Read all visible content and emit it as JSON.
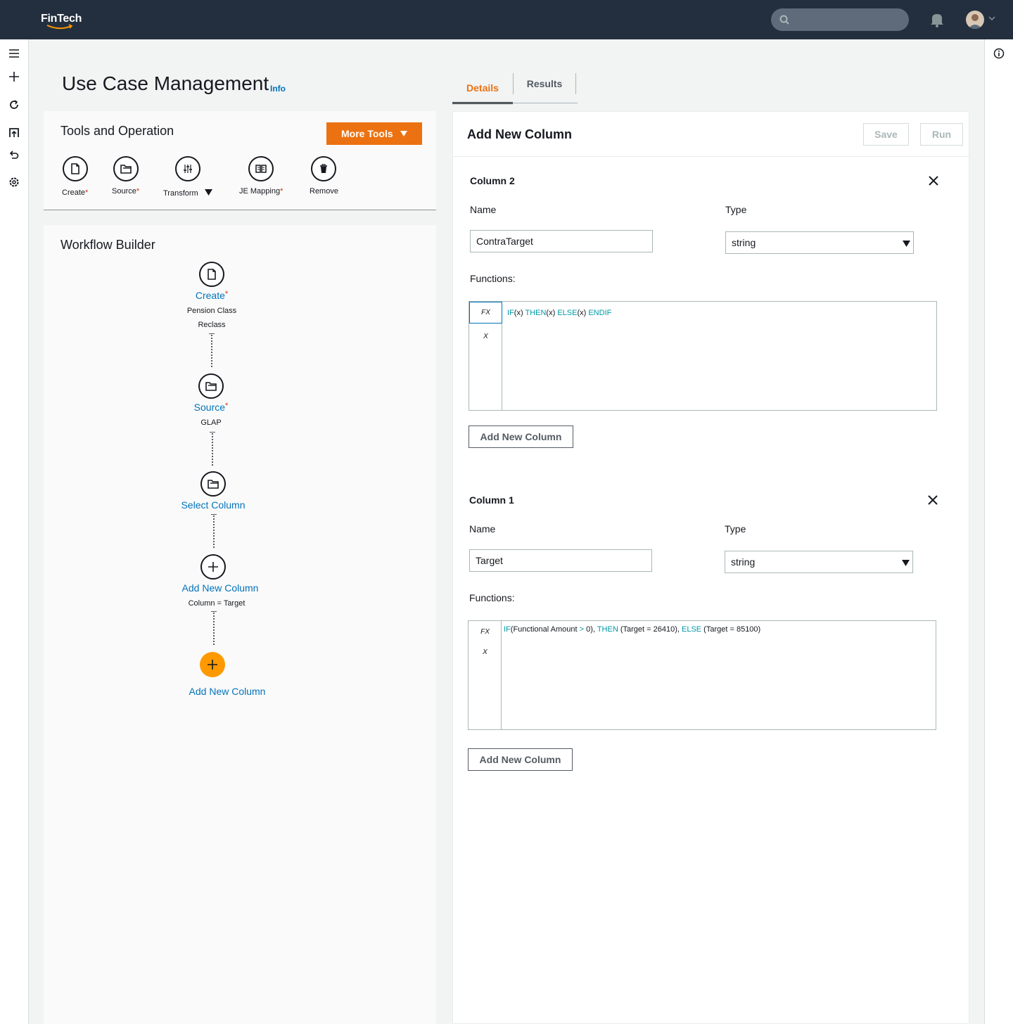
{
  "app": {
    "logo": "FinTech"
  },
  "page": {
    "title": "Use Case Management",
    "info_link": "Info"
  },
  "tabs": [
    {
      "label": "Details",
      "active": true
    },
    {
      "label": "Results",
      "active": false
    }
  ],
  "tools": {
    "heading": "Tools and Operation",
    "more_tools_label": "More Tools",
    "items": [
      {
        "label": "Create",
        "required": "*",
        "icon": "file-icon"
      },
      {
        "label": "Source",
        "required": "*",
        "icon": "folder-icon"
      },
      {
        "label": "Transform",
        "required": "",
        "icon": "sliders-icon"
      },
      {
        "label": "JE Mapping",
        "required": "*",
        "icon": "book-icon"
      },
      {
        "label": "Remove",
        "required": "",
        "icon": "trash-icon"
      }
    ]
  },
  "workflow": {
    "heading": "Workflow Builder",
    "nodes": [
      {
        "title": "Create",
        "required": "*",
        "sub1": "Pension Class",
        "sub2": "Reclass"
      },
      {
        "title": "Source",
        "required": "*",
        "sub1": "GLAP"
      },
      {
        "title": "Select Column"
      },
      {
        "title": "Add New Column",
        "sub1": "Column = Target"
      },
      {
        "title": "Add New Column"
      }
    ]
  },
  "detail": {
    "title": "Add New Column",
    "save_label": "Save",
    "run_label": "Run",
    "columns": [
      {
        "title": "Column 2",
        "name_label": "Name",
        "name_value": "ContraTarget",
        "type_label": "Type",
        "type_value": "string",
        "functions_label": "Functions:",
        "fx_label": "FX",
        "x_label": "X",
        "code": {
          "if": "IF",
          "x1": "(x) ",
          "then": "THEN",
          "x2": "(x) ",
          "else": "ELSE",
          "x3": "(x) ",
          "endif": "ENDIF"
        },
        "add_button": "Add New Column"
      },
      {
        "title": "Column 1",
        "name_label": "Name",
        "name_value": "Target",
        "type_label": "Type",
        "type_value": "string",
        "functions_label": "Functions:",
        "fx_label": "FX",
        "x_label": "X",
        "code": {
          "if": "IF",
          "p1": "(Functional Amount ",
          "gt": ">",
          "p2": " 0), ",
          "then": "THEN",
          "p3": " (Target = 26410), ",
          "else": "ELSE",
          "p4": " (Target = 85100)"
        },
        "add_button": "Add New Column"
      }
    ]
  },
  "colors": {
    "accent": "#ec7211",
    "link": "#0073bb",
    "keyword": "#0098a6",
    "topbar": "#232f3e",
    "node_orange": "#ff9900"
  }
}
